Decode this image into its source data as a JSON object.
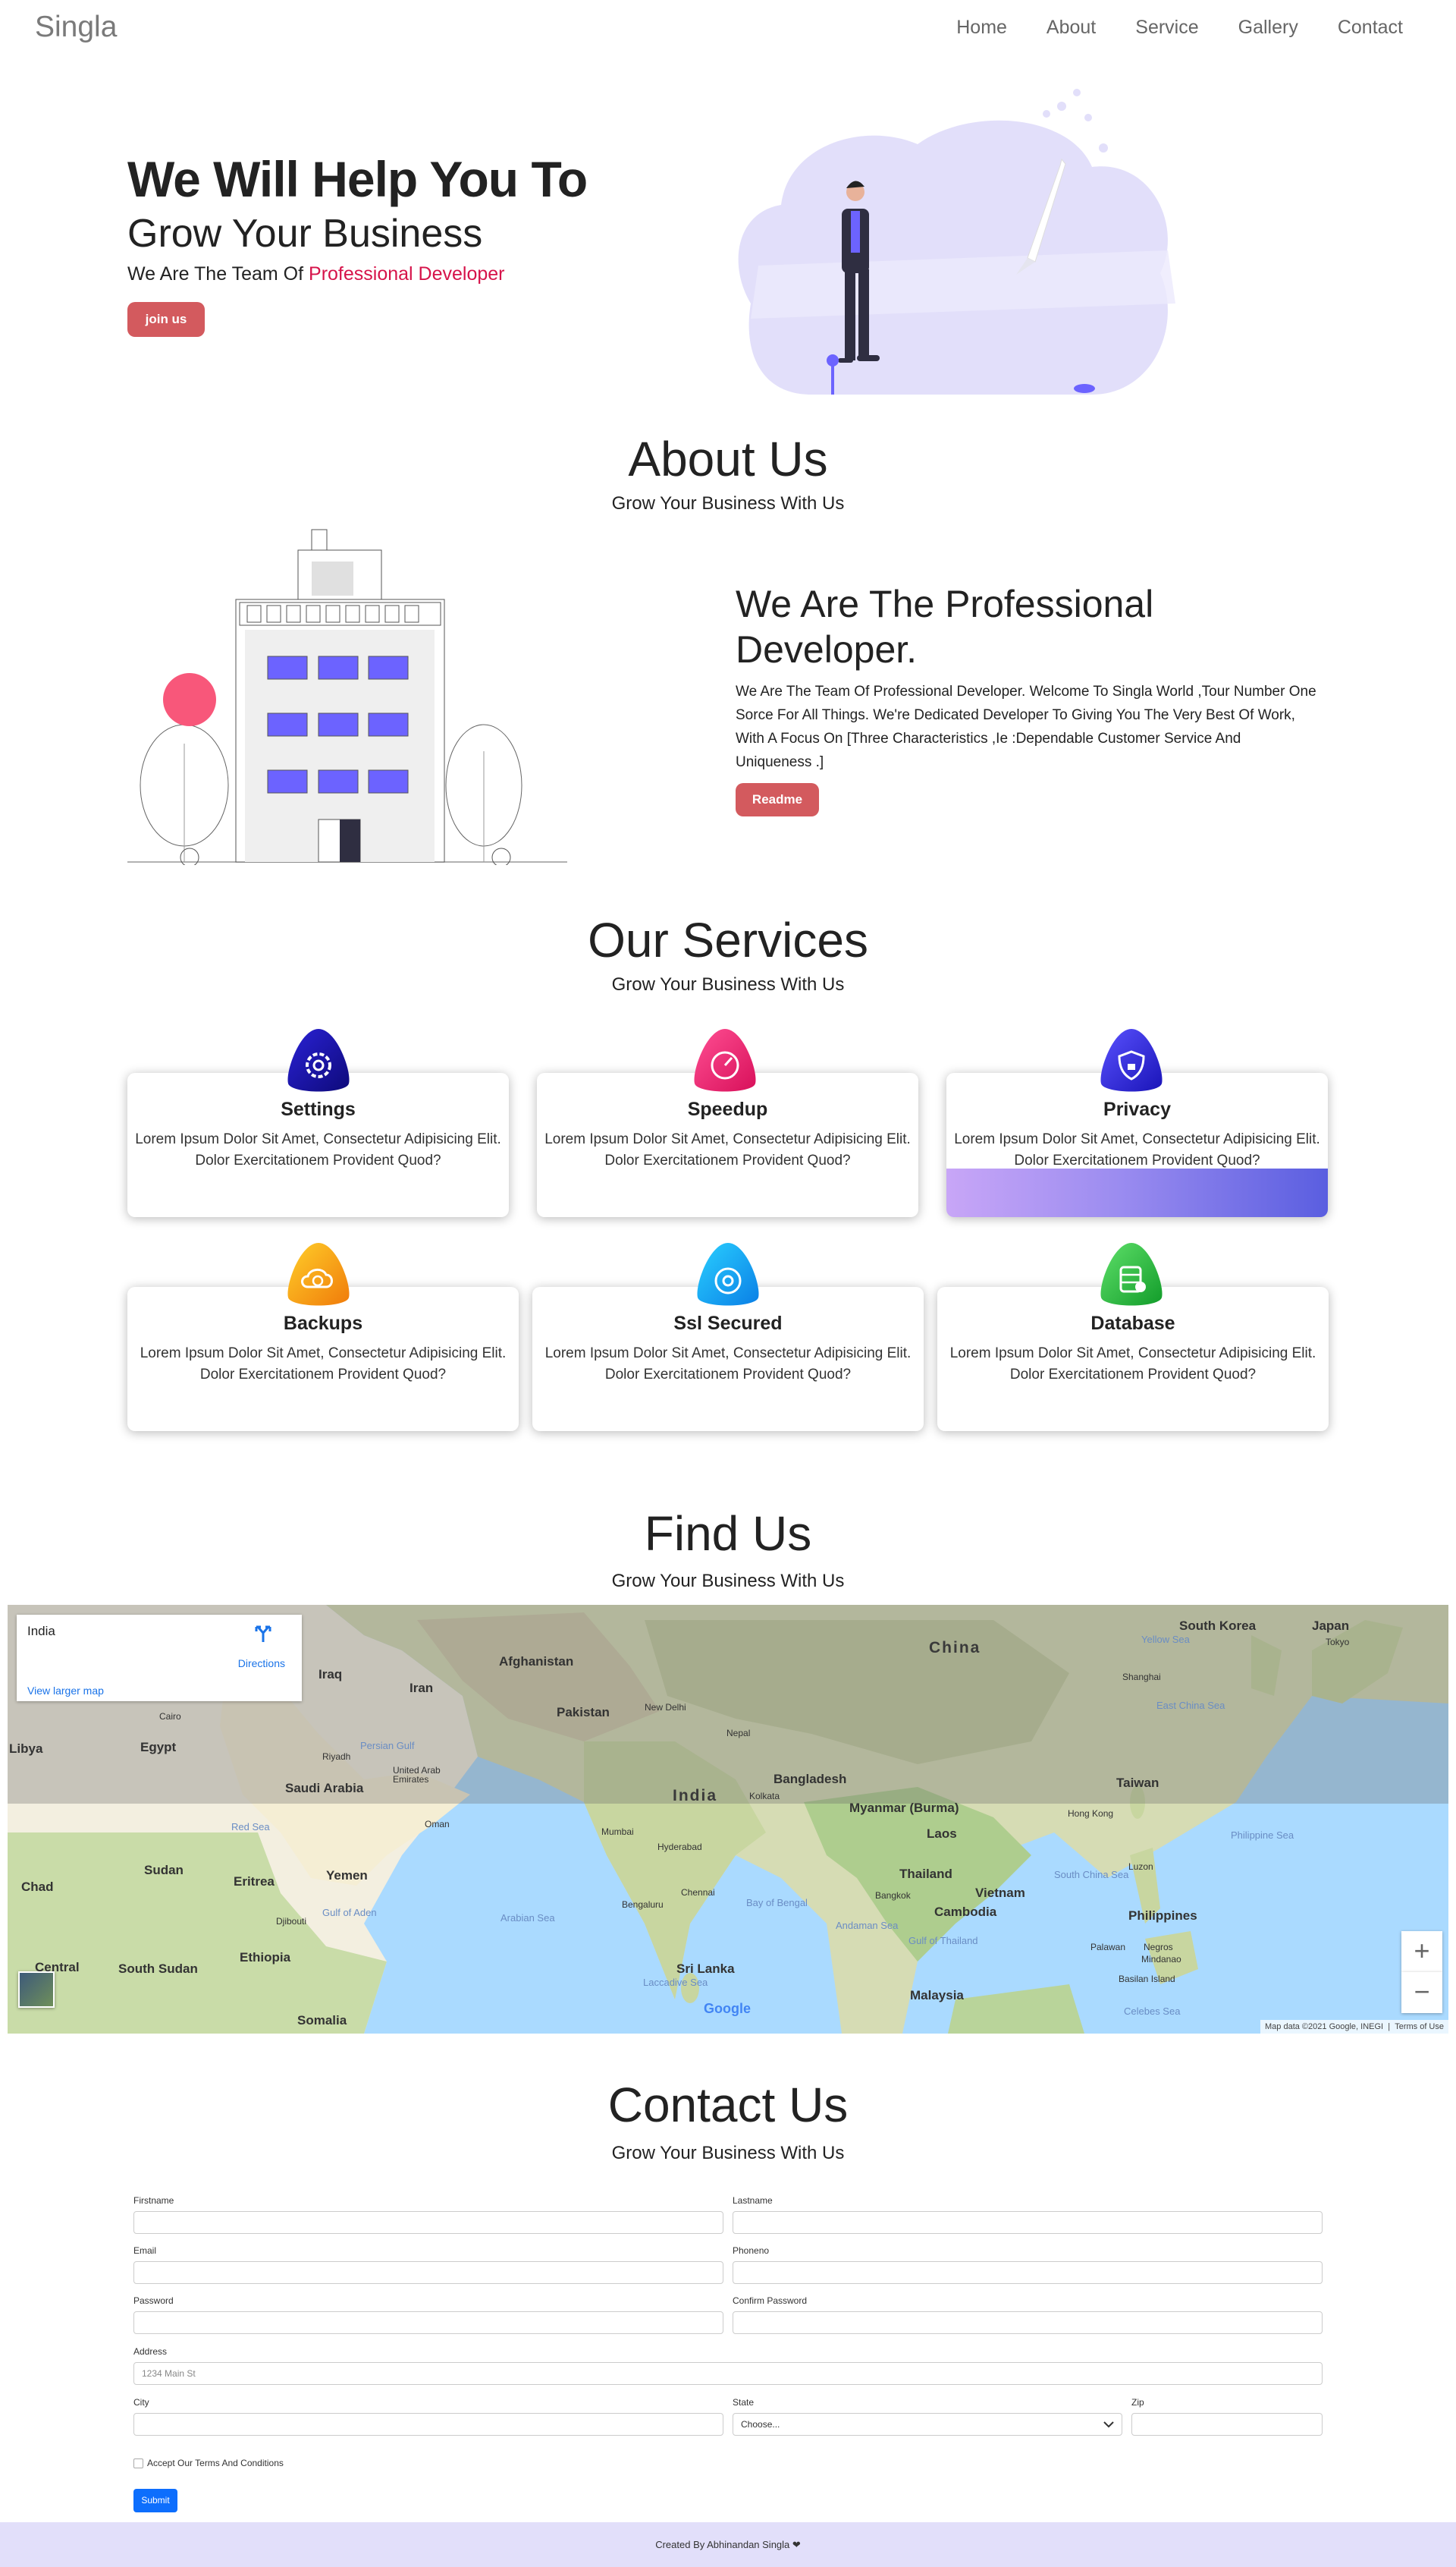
{
  "nav": {
    "brand": "Singla",
    "links": [
      "Home",
      "About",
      "Service",
      "Gallery",
      "Contact"
    ]
  },
  "hero": {
    "title1": "We Will Help You To",
    "title2": "Grow Your Business",
    "sub_prefix": "We Are The Team Of ",
    "sub_highlight": "Professional Developer",
    "button": "join us"
  },
  "about": {
    "title": "About Us",
    "subtitle": "Grow Your Business With Us",
    "heading": "We Are The Professional Developer.",
    "text": "We Are The Team Of Professional Developer. Welcome To Singla World ,Tour Number One Sorce For All Things. We're Dedicated Developer To Giving You The Very Best Of Work, With A Focus On [Three Characteristics ,Ie :Dependable Customer Service And Uniqueness .]",
    "button": "Readme"
  },
  "services": {
    "title": "Our Services",
    "subtitle": "Grow Your Business With Us",
    "items": [
      {
        "name": "Settings",
        "text": "Lorem Ipsum Dolor Sit Amet, Consectetur Adipisicing Elit. Dolor Exercitationem Provident Quod?",
        "icon": "gear-icon"
      },
      {
        "name": "Speedup",
        "text": "Lorem Ipsum Dolor Sit Amet, Consectetur Adipisicing Elit. Dolor Exercitationem Provident Quod?",
        "icon": "speedometer-icon"
      },
      {
        "name": "Privacy",
        "text": "Lorem Ipsum Dolor Sit Amet, Consectetur Adipisicing Elit. Dolor Exercitationem Provident Quod?",
        "icon": "shield-lock-icon"
      },
      {
        "name": "Backups",
        "text": "Lorem Ipsum Dolor Sit Amet, Consectetur Adipisicing Elit. Dolor Exercitationem Provident Quod?",
        "icon": "cloud-backup-icon"
      },
      {
        "name": "Ssl Secured",
        "text": "Lorem Ipsum Dolor Sit Amet, Consectetur Adipisicing Elit. Dolor Exercitationem Provident Quod?",
        "icon": "ssl-lock-icon"
      },
      {
        "name": "Database",
        "text": "Lorem Ipsum Dolor Sit Amet, Consectetur Adipisicing Elit. Dolor Exercitationem Provident Quod?",
        "icon": "database-icon"
      }
    ]
  },
  "find": {
    "title": "Find Us",
    "subtitle": "Grow Your Business With Us"
  },
  "map": {
    "place": "India",
    "directions": "Directions",
    "larger": "View larger map",
    "zoom_in": "+",
    "zoom_out": "−",
    "attribution": "Map data ©2021 Google, INEGI",
    "terms": "Terms of Use",
    "logo": "Google",
    "labels": {
      "china": "China",
      "india": "India",
      "south_korea": "South Korea",
      "japan": "Japan",
      "tokyo": "Tokyo",
      "yellow_sea": "Yellow Sea",
      "shanghai": "Shanghai",
      "east_china_sea": "East China Sea",
      "taiwan": "Taiwan",
      "hong_kong": "Hong Kong",
      "philippine_sea": "Philippine Sea",
      "luzon": "Luzon",
      "philippines": "Philippines",
      "palawan": "Palawan",
      "negros": "Negros",
      "mindanao": "Mindanao",
      "basilan": "Basilan Island",
      "celebes": "Celebes Sea",
      "afghanistan": "Afghanistan",
      "iran": "Iran",
      "iraq": "Iraq",
      "pakistan": "Pakistan",
      "new_delhi": "New Delhi",
      "nepal": "Nepal",
      "bangladesh": "Bangladesh",
      "kolkata": "Kolkata",
      "myanmar": "Myanmar (Burma)",
      "laos": "Laos",
      "thailand": "Thailand",
      "vietnam": "Vietnam",
      "cambodia": "Cambodia",
      "bangkok": "Bangkok",
      "south_china_sea": "South China Sea",
      "andaman": "Andaman Sea",
      "gulf_thailand": "Gulf of Thailand",
      "malaysia": "Malaysia",
      "sri_lanka": "Sri Lanka",
      "bay_bengal": "Bay of Bengal",
      "arabian_sea": "Arabian Sea",
      "laccadive": "Laccadive Sea",
      "mumbai": "Mumbai",
      "hyderabad": "Hyderabad",
      "chennai": "Chennai",
      "bengaluru": "Bengaluru",
      "libya": "Libya",
      "egypt": "Egypt",
      "cairo": "Cairo",
      "riyadh": "Riyadh",
      "saudi": "Saudi Arabia",
      "uae": "United Arab Emirates",
      "persian_gulf": "Persian Gulf",
      "oman": "Oman",
      "red_sea": "Red Sea",
      "sudan": "Sudan",
      "chad": "Chad",
      "eritrea": "Eritrea",
      "yemen": "Yemen",
      "djibouti": "Djibouti",
      "gulf_aden": "Gulf of Aden",
      "ethiopia": "Ethiopia",
      "south_sudan": "South Sudan",
      "central": "Central",
      "somalia": "Somalia"
    }
  },
  "contact": {
    "title": "Contact Us",
    "subtitle": "Grow Your Business With Us",
    "labels": {
      "firstname": "Firstname",
      "lastname": "Lastname",
      "email": "Email",
      "phoneno": "Phoneno",
      "password": "Password",
      "confirm": "Confirm Password",
      "address": "Address",
      "city": "City",
      "state": "State",
      "zip": "Zip"
    },
    "address_placeholder": "1234 Main St",
    "state_value": "Choose...",
    "checkbox": "Accept Our Terms And Conditions",
    "submit": "Submit"
  },
  "footer": {
    "text": "Created By Abhinandan Singla ❤"
  },
  "colors": {
    "accent_red": "#d35a5e",
    "highlight": "#d6134a",
    "purple": "#6c63ff",
    "footer_bg": "#e2dffa",
    "submit_blue": "#0d6efd"
  }
}
